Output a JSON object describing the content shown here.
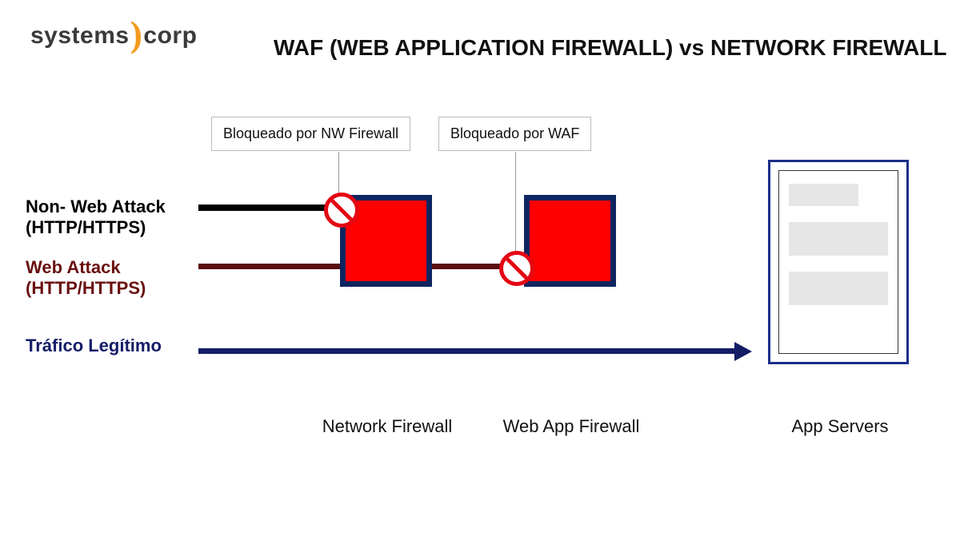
{
  "logo": {
    "left": "systems",
    "right": "corp"
  },
  "title": "WAF (WEB APPLICATION FIREWALL) vs NETWORK FIREWALL",
  "legend": {
    "non_web_attack": "Non- Web Attack (HTTP/HTTPS)",
    "web_attack": "Web Attack (HTTP/HTTPS)",
    "legit_traffic": "Tráfico Legítimo"
  },
  "callouts": {
    "nw_firewall_block": "Bloqueado por NW Firewall",
    "waf_block": "Bloqueado por WAF"
  },
  "labels": {
    "network_firewall": "Network Firewall",
    "webapp_firewall": "Web App Firewall",
    "app_servers": "App Servers"
  },
  "colors": {
    "brand_orange": "#f59a1f",
    "firewall_fill": "#ff0000",
    "firewall_border": "#0e2560",
    "nonweb_line": "#000000",
    "web_line": "#5a0f0f",
    "legit_line": "#141d66",
    "block_red": "#e30613",
    "server_border": "#1b2e8a"
  }
}
